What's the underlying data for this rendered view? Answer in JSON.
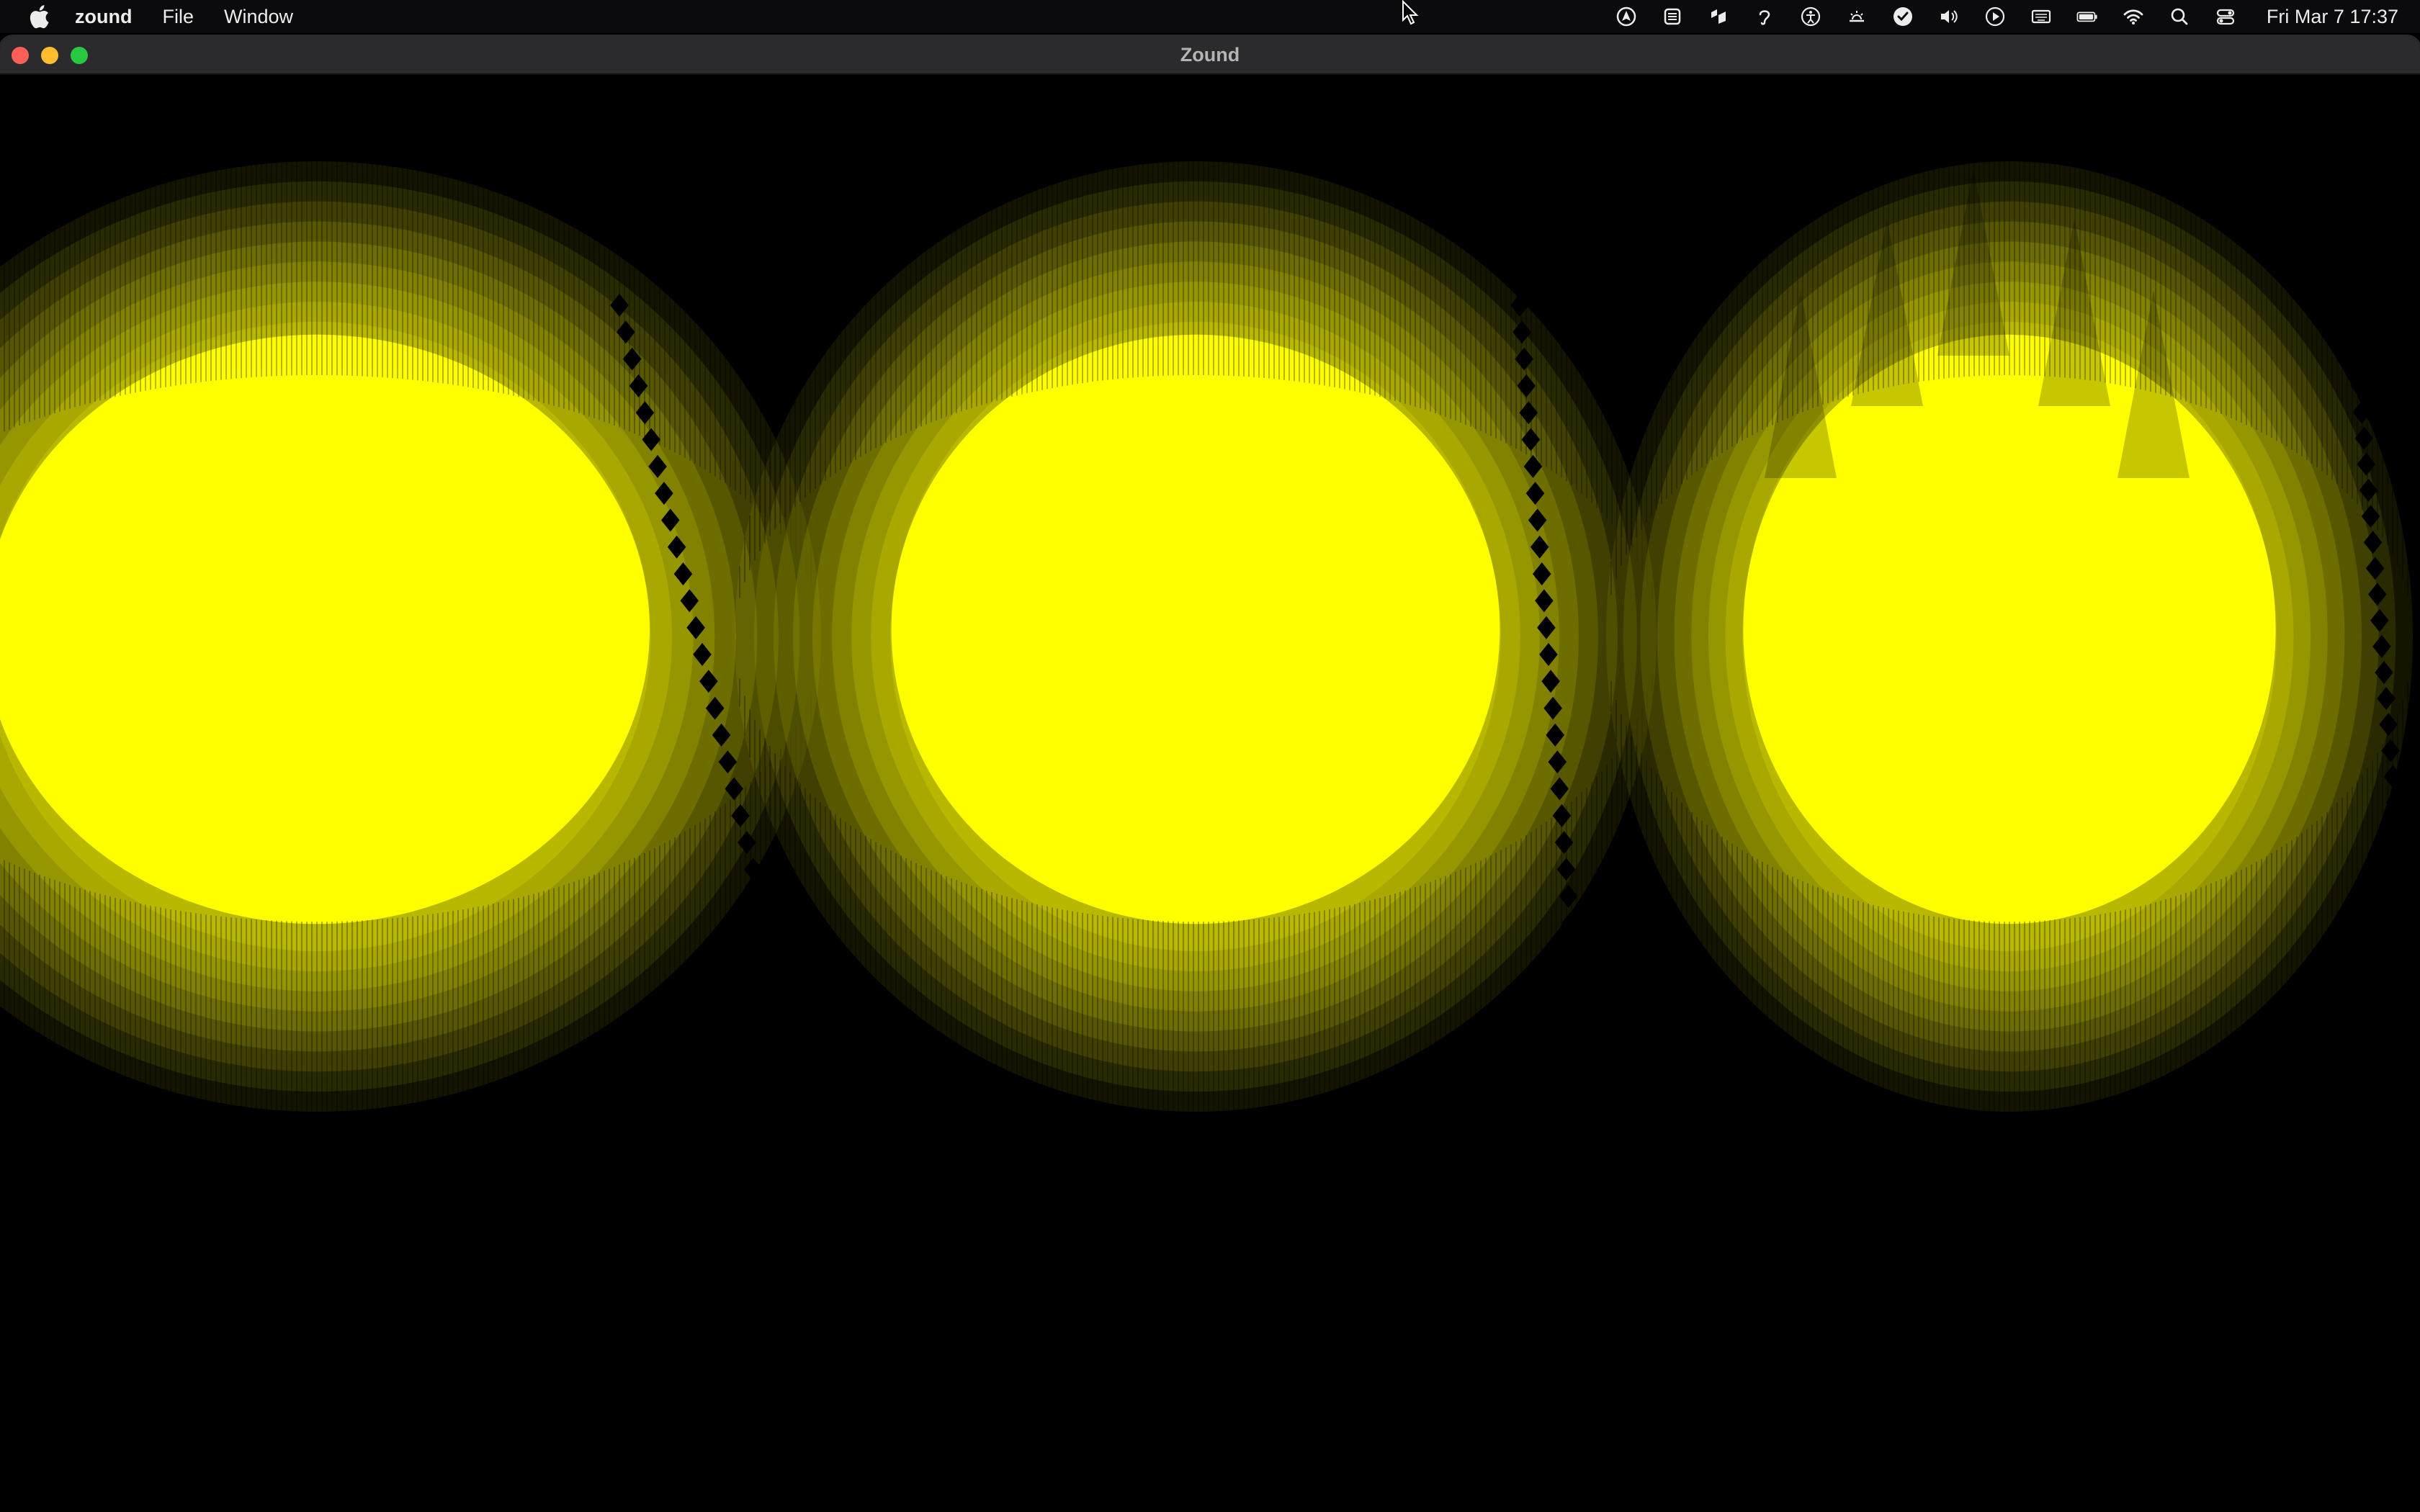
{
  "menubar": {
    "apple_icon": "apple-icon",
    "app_name": "zound",
    "menus": [
      {
        "label": "File"
      },
      {
        "label": "Window"
      }
    ],
    "status_icons": [
      "vpn-icon",
      "extension-icon",
      "dropbox-icon",
      "hearing-icon",
      "accessibility-icon",
      "brightness-icon",
      "checkmark-icon",
      "volume-icon",
      "play-icon",
      "keyboard-icon",
      "battery-icon",
      "wifi-icon",
      "search-icon",
      "control-center-icon"
    ],
    "clock": "Fri Mar 7  17:37"
  },
  "window": {
    "title": "Zound"
  },
  "visualizer": {
    "color": "#ffff00",
    "background": "#000000"
  }
}
